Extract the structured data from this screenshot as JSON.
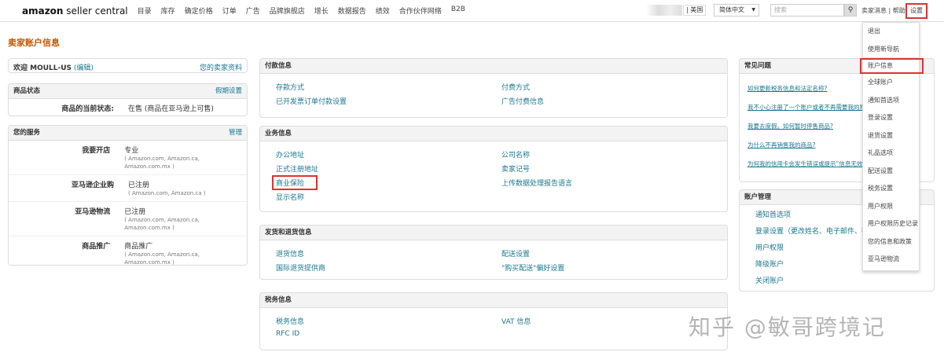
{
  "header": {
    "logo_bold": "amazon",
    "logo_rest": " seller central",
    "nav": [
      "目录",
      "库存",
      "确定价格",
      "订单",
      "广告",
      "品牌旗舰店",
      "增长",
      "数据报告",
      "绩效",
      "合作伙伴网络",
      "B2B"
    ],
    "marketplace": "| 美国",
    "language": "简体中文",
    "search_placeholder": "搜索",
    "messages": "卖家消息",
    "help": "帮助",
    "settings": "设置"
  },
  "page_title": "卖家账户信息",
  "welcome": {
    "text": "欢迎 MOULL-US",
    "edit": "(编辑)",
    "profile_link": "您的卖家资料"
  },
  "listing_status": {
    "title": "商品状态",
    "action": "假期设置",
    "label": "商品的当前状态:",
    "value": "在售 (商品在亚马逊上可售)"
  },
  "services": {
    "title": "您的服务",
    "action": "管理",
    "rows": [
      {
        "label": "我要开店",
        "value": "专业",
        "detail": "( Amazon.com, Amazon.ca, Amazon.com.mx )"
      },
      {
        "label": "亚马逊企业购",
        "value": "已注册",
        "detail": "( Amazon.com, Amazon.ca )"
      },
      {
        "label": "亚马逊物流",
        "value": "已注册",
        "detail": "( Amazon.com, Amazon.ca, Amazon.com.mx )"
      },
      {
        "label": "商品推广",
        "value": "商品推广",
        "detail": "( Amazon.com, Amazon.ca, Amazon.com.mx )"
      }
    ]
  },
  "payment": {
    "title": "付款信息",
    "links": [
      "存款方式",
      "付费方式",
      "已开发票订单付款设置",
      "广告付费信息"
    ]
  },
  "business": {
    "title": "业务信息",
    "links": [
      "办公地址",
      "公司名称",
      "正式注册地址",
      "卖家记号",
      "商业保险",
      "上传数据处理报告语言",
      "显示名称"
    ]
  },
  "shipping": {
    "title": "发货和退货信息",
    "links": [
      "退货信息",
      "配送设置",
      "国际退货提供商",
      "\"购买配送\"偏好设置"
    ]
  },
  "tax": {
    "title": "税务信息",
    "links": [
      "税务信息",
      "VAT 信息",
      "RFC ID"
    ]
  },
  "faq": {
    "title": "常见问题",
    "items": [
      "如何更新税务信息和法定名称?",
      "我不小心注册了一个账户或者不再需要我的账户",
      "我要去度假。如何暂时停售商品?",
      "为什么不再销售我的商品?",
      "为何我的信用卡会发生错误或提示“信息无效”"
    ]
  },
  "account_mgmt": {
    "title": "账户管理",
    "items": [
      "通知首选项",
      "登录设置（更改姓名、电子邮件、密码",
      "用户权限",
      "降级账户",
      "关闭账户"
    ]
  },
  "settings_menu": [
    "退出",
    "使用新导航",
    "账户信息",
    "全球账户",
    "通知首选项",
    "登录设置",
    "退货设置",
    "礼品选项",
    "配送设置",
    "税务设置",
    "用户权限",
    "用户权限历史记录",
    "您的信息和政策",
    "亚马逊物流"
  ],
  "watermark": "知乎 @敏哥跨境记"
}
